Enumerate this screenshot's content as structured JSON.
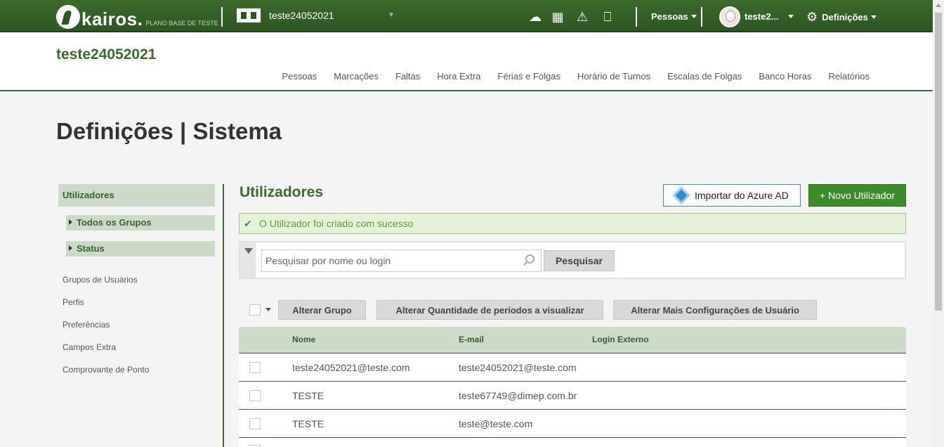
{
  "topbar": {
    "logo_text": "kairos.",
    "logo_subtitle": "PLANO BASE DE TESTE",
    "company_selector": "teste24052021",
    "icons": [
      "cloud-download-icon",
      "calculator-icon",
      "warning-icon",
      "inbox-icon"
    ],
    "people_menu": "Pessoas",
    "user_name": "teste2...",
    "settings_menu": "Definições"
  },
  "header": {
    "company_title": "teste24052021",
    "nav": [
      "Pessoas",
      "Marcações",
      "Faltas",
      "Hora Extra",
      "Férias e Folgas",
      "Horário de Turnos",
      "Escalas de Folgas",
      "Banco Horas",
      "Relatórios"
    ]
  },
  "page_title": "Definições | Sistema",
  "sidebar": {
    "active": "Utilizadores",
    "sub": [
      "Todos os Grupos",
      "Status"
    ],
    "links": [
      "Grupos de Usuários",
      "Perfis",
      "Preferências",
      "Campos Extra",
      "Comprovante de Ponto"
    ]
  },
  "main": {
    "section_title": "Utilizadores",
    "azure_button": "Importar do Azure AD",
    "new_button": "+ Novo Utilizador",
    "success_message": "O Utilizador foi criado com sucesso",
    "search": {
      "placeholder": "Pesquisar por nome ou login",
      "button": "Pesquisar"
    },
    "bulk_actions": [
      "Alterar Grupo",
      "Alterar Quantidade de períodos a visualizar",
      "Alterar Mais Configurações de Usuário"
    ],
    "table": {
      "columns": [
        "Nome",
        "E-mail",
        "Login Externo"
      ],
      "rows": [
        {
          "nome": "teste24052021@teste.com",
          "email": "teste24052021@teste.com",
          "login": ""
        },
        {
          "nome": "TESTE",
          "email": "teste67749@dimep.com.br",
          "login": ""
        },
        {
          "nome": "TESTE",
          "email": "teste@teste.com",
          "login": ""
        }
      ]
    }
  }
}
